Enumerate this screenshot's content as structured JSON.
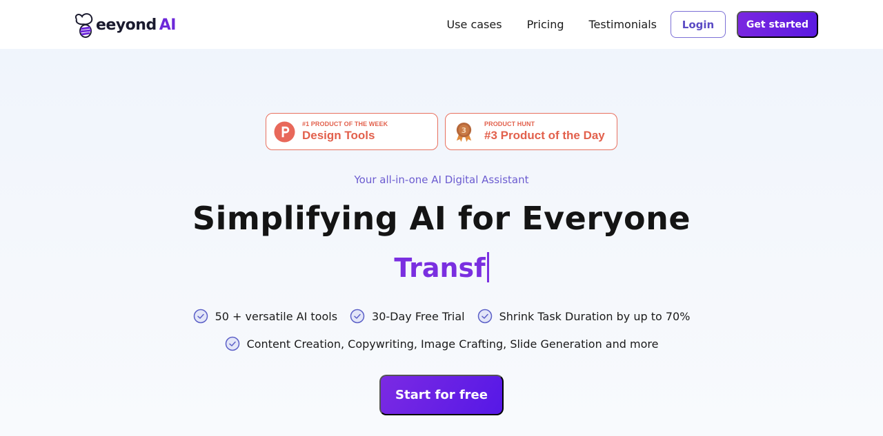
{
  "header": {
    "logo": {
      "name": "eeyond",
      "suffix": "AI",
      "icon": "bee-icon"
    },
    "nav": [
      {
        "label": "Use cases"
      },
      {
        "label": "Pricing"
      },
      {
        "label": "Testimonials"
      }
    ],
    "login_label": "Login",
    "get_started_label": "Get started"
  },
  "badges": [
    {
      "icon": "product-hunt-p-icon",
      "kicker": "#1 PRODUCT OF THE WEEK",
      "title": "Design Tools"
    },
    {
      "icon": "bronze-medal-3-icon",
      "medal_number": "3",
      "kicker": "PRODUCT HUNT",
      "title": "#3 Product of the Day"
    }
  ],
  "hero": {
    "tagline": "Your all-in-one AI Digital Assistant",
    "headline": "Simplifying AI for Everyone",
    "typed_text": "Transf"
  },
  "features": {
    "row1": [
      {
        "icon": "check-circle-icon",
        "label": "50 + versatile AI tools"
      },
      {
        "icon": "check-circle-icon",
        "label": "30-Day Free Trial"
      },
      {
        "icon": "check-circle-icon",
        "label": "Shrink Task Duration by up to 70%"
      }
    ],
    "row2": [
      {
        "icon": "check-circle-icon",
        "label": "Content Creation, Copywriting, Image Crafting, Slide Generation and more"
      }
    ]
  },
  "cta": {
    "label": "Start for free"
  },
  "colors": {
    "brand_purple": "#6d28d9",
    "accent_coral": "#e2604c",
    "check_blue": "#5b5fc7"
  }
}
